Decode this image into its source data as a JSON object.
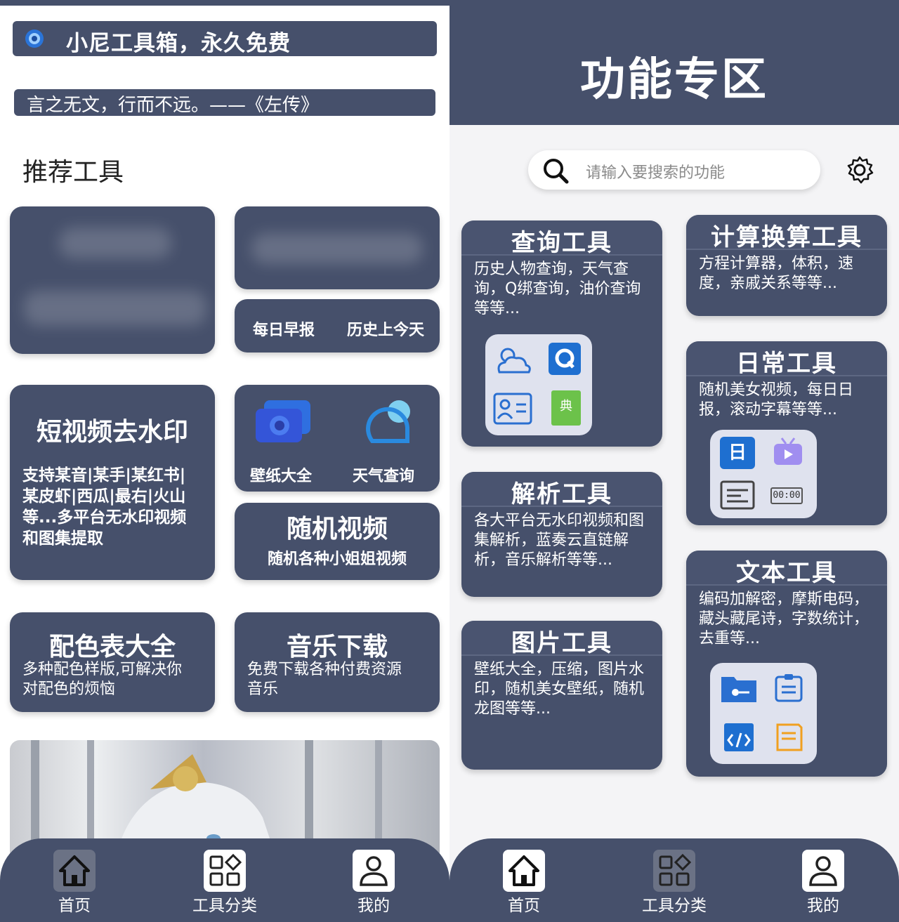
{
  "left": {
    "banner": {
      "icon": "speaker-icon",
      "text": "小尼工具箱，永久免费"
    },
    "quote": "言之无文，行而不远。——《左传》",
    "section_title": "推荐工具",
    "daily_pill": {
      "left": "每日早报",
      "right": "历史上今天"
    },
    "watermark_card": {
      "title": "短视频去水印",
      "desc_lines": [
        "支持某音|某手|某红书|",
        "某皮虾|西瓜|最右|火山",
        "等...多平台无水印视频",
        "和图集提取"
      ]
    },
    "wallpaper_weather": {
      "left_label": "壁纸大全",
      "right_label": "天气查询",
      "left_icon": "wallpaper-icon",
      "right_icon": "weather-icon"
    },
    "random_video": {
      "title": "随机视频",
      "desc": "随机各种小姐姐视频"
    },
    "color_card": {
      "title": "配色表大全",
      "desc_lines": [
        "多种配色样版,可解决你",
        "对配色的烦恼"
      ]
    },
    "music_card": {
      "title": "音乐下载",
      "desc_lines": [
        "免费下载各种付费资源",
        "音乐"
      ]
    }
  },
  "nav": {
    "items": [
      {
        "label": "首页",
        "icon": "home-icon"
      },
      {
        "label": "工具分类",
        "icon": "grid-icon"
      },
      {
        "label": "我的",
        "icon": "user-icon"
      }
    ],
    "left_active": 0,
    "right_active": 1
  },
  "right": {
    "title": "功能专区",
    "search": {
      "placeholder": "请输入要搜索的功能",
      "icon": "search-icon"
    },
    "settings_icon": "gear-icon",
    "cards": {
      "query": {
        "title": "查询工具",
        "desc_lines": [
          "历史人物查询，天气查",
          "询，Q绑查询，油价查询",
          "等等..."
        ]
      },
      "calc": {
        "title": "计算换算工具",
        "desc_lines": [
          "方程计算器，体积，速",
          "度，亲戚关系等等..."
        ]
      },
      "daily": {
        "title": "日常工具",
        "desc_lines": [
          "随机美女视频，每日日",
          "报，滚动字幕等等..."
        ]
      },
      "parse": {
        "title": "解析工具",
        "desc_lines": [
          "各大平台无水印视频和图",
          "集解析，蓝奏云直链解",
          "析，音乐解析等等..."
        ]
      },
      "text": {
        "title": "文本工具",
        "desc_lines": [
          "编码加解密，摩斯电码，",
          "藏头藏尾诗，字数统计，",
          "去重等..."
        ]
      },
      "image": {
        "title": "图片工具",
        "desc_lines": [
          "壁纸大全，压缩，图片水",
          "印，随机美女壁纸，随机",
          "龙图等等..."
        ]
      }
    },
    "icon_labels": {
      "dict": "典",
      "calendar": "日",
      "timer": "00:00"
    }
  },
  "colors": {
    "navy": "#46506b",
    "accent_blue": "#1e6fd0",
    "accent_green": "#6cc24a"
  }
}
